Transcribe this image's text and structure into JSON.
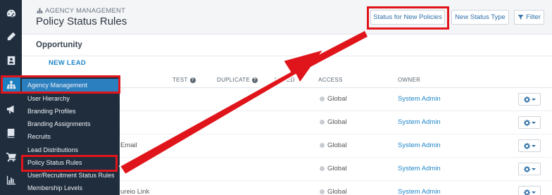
{
  "header": {
    "breadcrumb": "AGENCY MANAGEMENT",
    "title": "Policy Status Rules",
    "buttons": {
      "status_new_policies": "Status for New Policies",
      "new_status_type": "New Status Type",
      "filter": "Filter"
    }
  },
  "rail_icons": [
    "dashboard-icon",
    "pencil-icon",
    "contact-card-icon",
    "org-chart-icon",
    "megaphone-icon",
    "book-icon",
    "cart-icon",
    "bar-chart-icon"
  ],
  "panel": {
    "section_title": "Opportunity",
    "group_label": "NEW LEAD",
    "columns": {
      "test": "TEST",
      "duplicate": "DUPLICATE",
      "closed": "LOSED",
      "access": "ACCESS",
      "owner": "OWNER"
    },
    "rows": [
      {
        "name": "",
        "access": "Global",
        "owner": "System Admin"
      },
      {
        "name": "",
        "access": "Global",
        "owner": "System Admin"
      },
      {
        "name": "Email",
        "access": "Global",
        "owner": "System Admin"
      },
      {
        "name": "ext",
        "access": "Global",
        "owner": "System Admin"
      },
      {
        "name": "ureio Link",
        "access": "Global",
        "owner": "System Admin"
      }
    ]
  },
  "flyout": {
    "items": [
      "Agency Management",
      "User Hierarchy",
      "Branding Profiles",
      "Branding Assignments",
      "Recruits",
      "Lead Distributions",
      "Policy Status Rules",
      "User/Recruitment Status Rules",
      "Membership Levels"
    ]
  },
  "colors": {
    "rail": "#1f2d3d",
    "accent": "#1b7fc0",
    "annotation": "#e0151b",
    "link": "#1f86c8"
  }
}
